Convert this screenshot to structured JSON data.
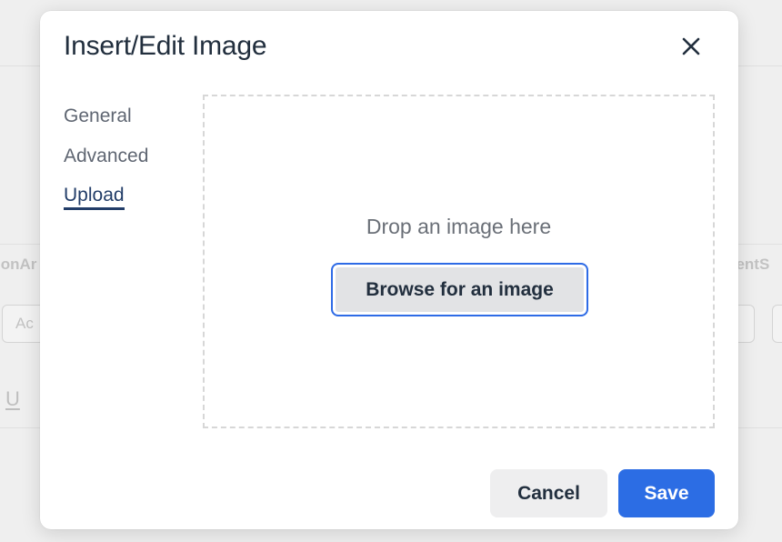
{
  "background": {
    "left_label": "ionAr",
    "right_label": "lientS",
    "left_field_text": "Ac",
    "underline_glyph": "U"
  },
  "dialog": {
    "title": "Insert/Edit Image",
    "close_icon": "close-icon",
    "tabs": [
      {
        "label": "General",
        "active": false
      },
      {
        "label": "Advanced",
        "active": false
      },
      {
        "label": "Upload",
        "active": true
      }
    ],
    "upload": {
      "drop_text": "Drop an image here",
      "browse_label": "Browse for an image"
    },
    "footer": {
      "cancel_label": "Cancel",
      "save_label": "Save"
    }
  },
  "colors": {
    "accent": "#2c6de4",
    "title_text": "#222f3e",
    "active_tab": "#223d68",
    "tab_text": "#5f6672",
    "dropzone_border": "#d7d7d7"
  }
}
